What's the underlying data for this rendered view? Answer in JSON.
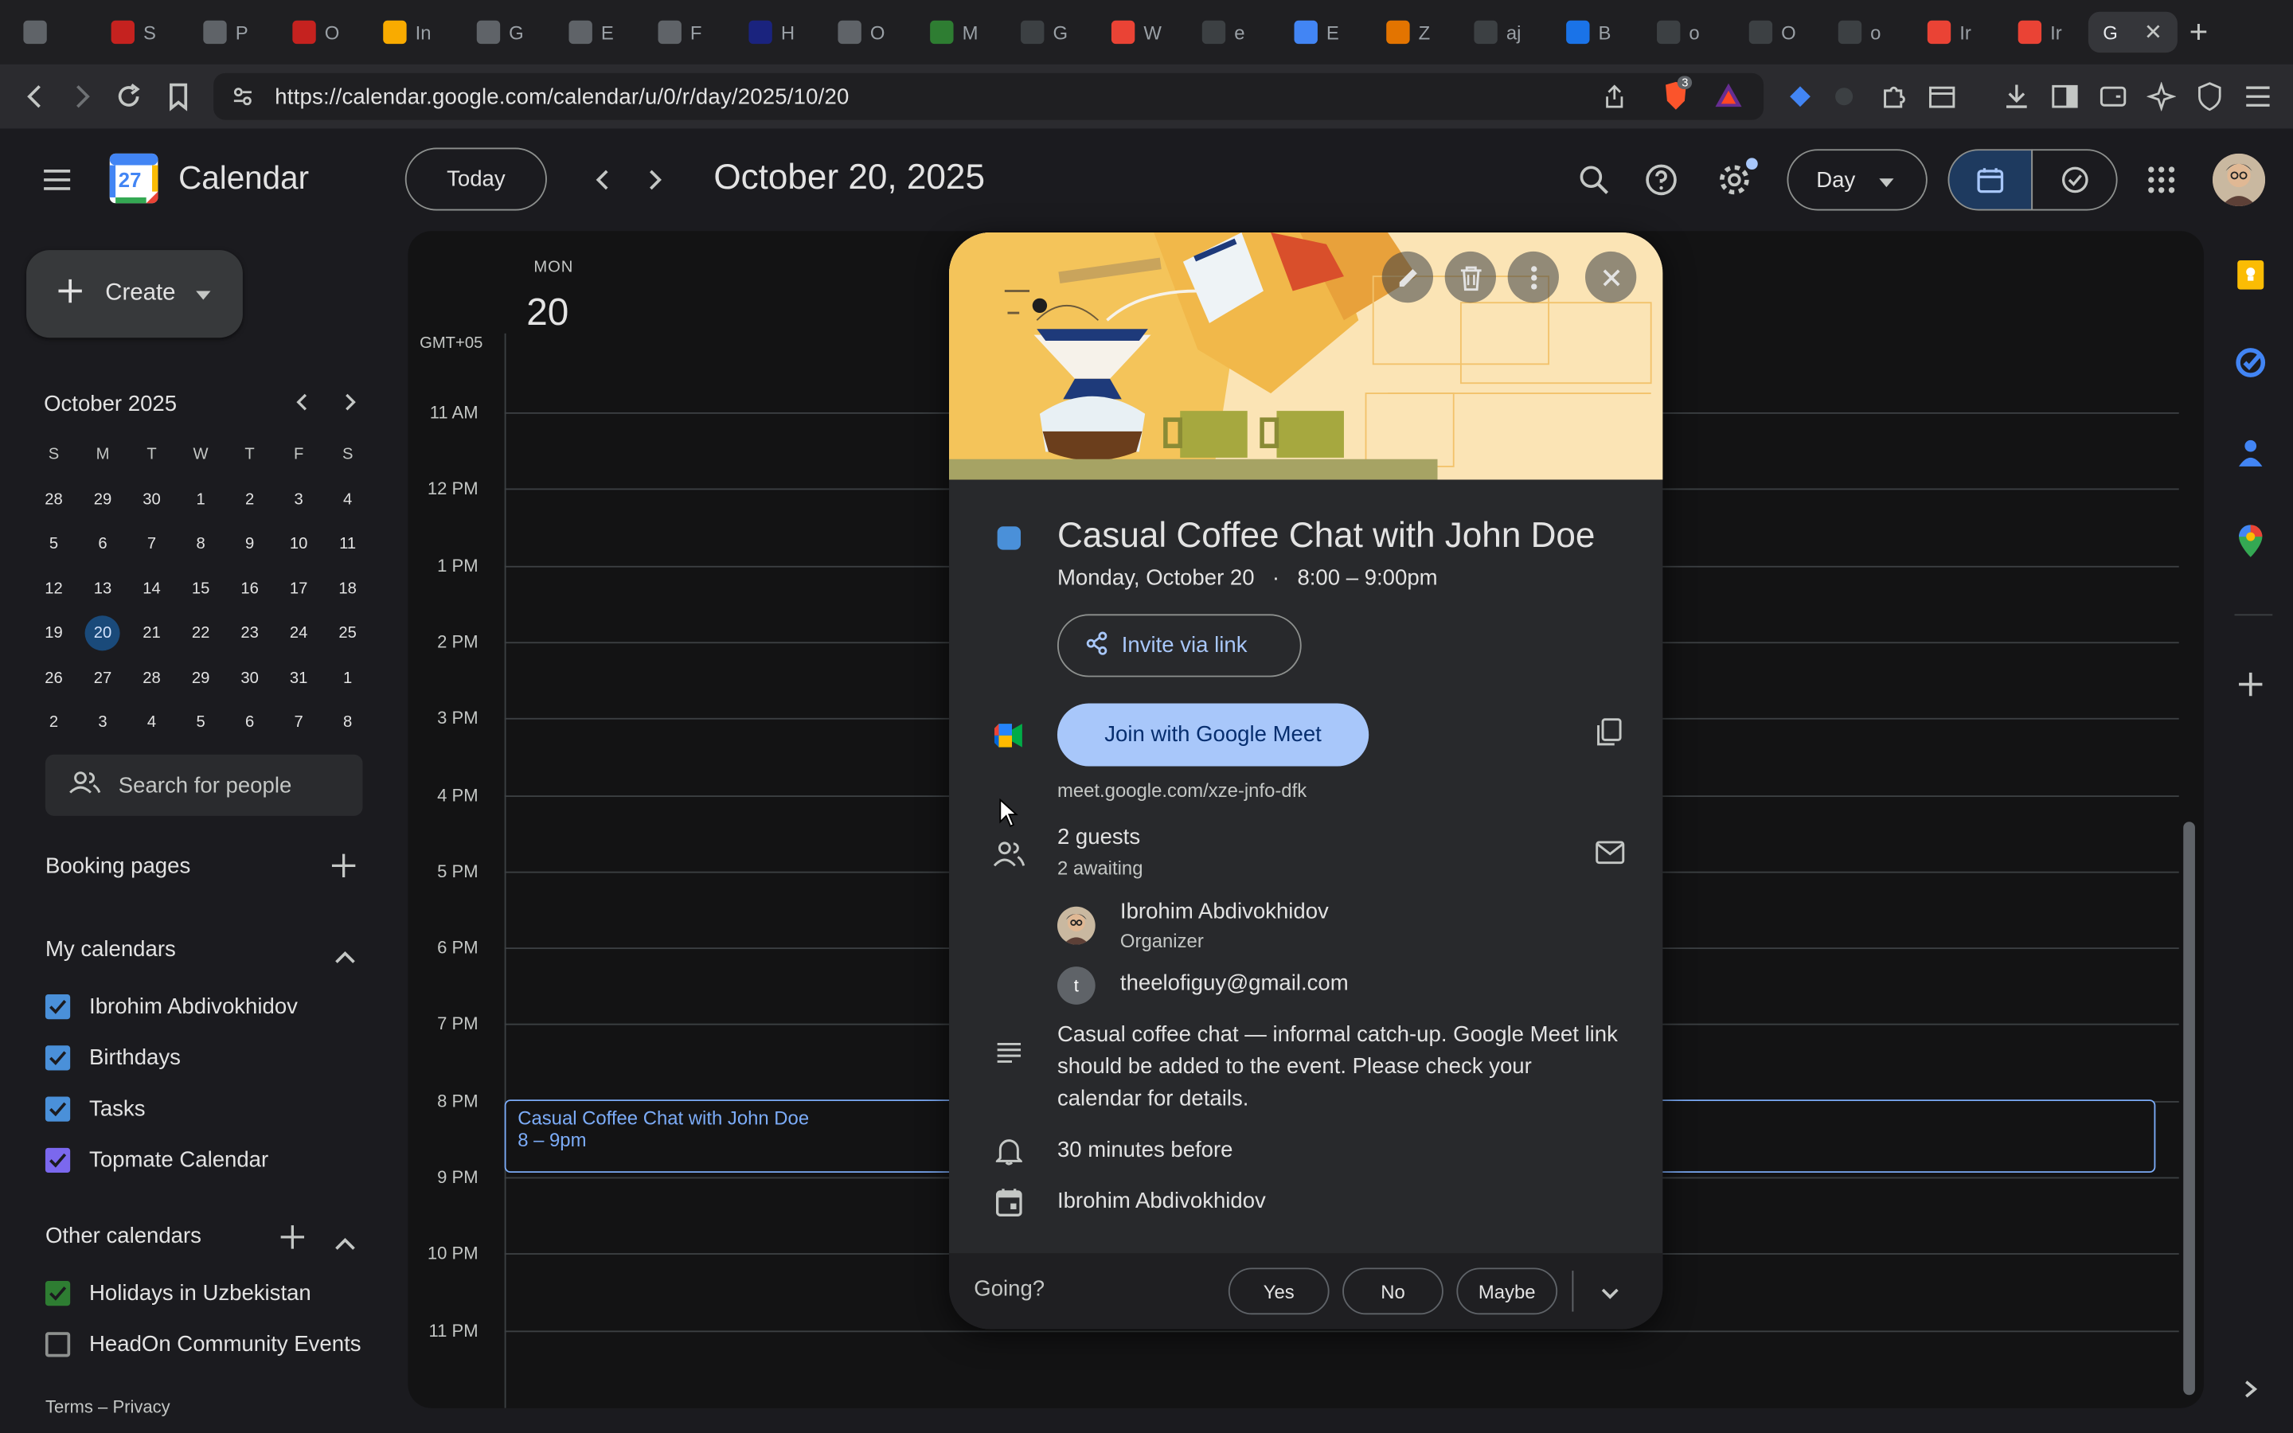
{
  "browser": {
    "tabs": [
      {
        "label": "S",
        "color": "#c5221f"
      },
      {
        "label": "P",
        "color": "#5f6368"
      },
      {
        "label": "O",
        "color": "#c5221f"
      },
      {
        "label": "In",
        "color": "#f9ab00"
      },
      {
        "label": "G",
        "color": "#5f6368"
      },
      {
        "label": "E",
        "color": "#5f6368"
      },
      {
        "label": "F",
        "color": "#5f6368"
      },
      {
        "label": "H",
        "color": "#1a237e"
      },
      {
        "label": "O",
        "color": "#5f6368"
      },
      {
        "label": "M",
        "color": "#2e7d32"
      },
      {
        "label": "G",
        "color": "#3c4043"
      },
      {
        "label": "W",
        "color": "#ea4335"
      },
      {
        "label": "e",
        "color": "#3c4043"
      },
      {
        "label": "E",
        "color": "#4285f4"
      },
      {
        "label": "Z",
        "color": "#e37400"
      },
      {
        "label": "aj",
        "color": "#3c4043"
      },
      {
        "label": "B",
        "color": "#1a73e8"
      },
      {
        "label": "o",
        "color": "#3c4043"
      },
      {
        "label": "O",
        "color": "#3c4043"
      },
      {
        "label": "o",
        "color": "#3c4043"
      },
      {
        "label": "Ir",
        "color": "#ea4335"
      },
      {
        "label": "Ir",
        "color": "#ea4335"
      }
    ],
    "active_tab": {
      "label": "G"
    },
    "url": "https://calendar.google.com/calendar/u/0/r/day/2025/10/20",
    "brave_badge": "3"
  },
  "header": {
    "app_name": "Calendar",
    "logo_day": "27",
    "today_label": "Today",
    "date_title": "October 20, 2025",
    "view_label": "Day"
  },
  "sidebar": {
    "create_label": "Create",
    "minical": {
      "title": "October 2025",
      "weekdays": [
        "S",
        "M",
        "T",
        "W",
        "T",
        "F",
        "S"
      ],
      "days": [
        "28",
        "29",
        "30",
        "1",
        "2",
        "3",
        "4",
        "5",
        "6",
        "7",
        "8",
        "9",
        "10",
        "11",
        "12",
        "13",
        "14",
        "15",
        "16",
        "17",
        "18",
        "19",
        "20",
        "21",
        "22",
        "23",
        "24",
        "25",
        "26",
        "27",
        "28",
        "29",
        "30",
        "31",
        "1",
        "2",
        "3",
        "4",
        "5",
        "6",
        "7",
        "8"
      ],
      "today": "20"
    },
    "search_people_placeholder": "Search for people",
    "booking_pages": "Booking pages",
    "my_calendars_title": "My calendars",
    "my_calendars": [
      {
        "name": "Ibrohim Abdivokhidov",
        "color": "#4a90d9",
        "checked": true
      },
      {
        "name": "Birthdays",
        "color": "#4a90d9",
        "checked": true
      },
      {
        "name": "Tasks",
        "color": "#4a90d9",
        "checked": true
      },
      {
        "name": "Topmate Calendar",
        "color": "#7b68ee",
        "checked": true
      }
    ],
    "other_calendars_title": "Other calendars",
    "other_calendars": [
      {
        "name": "Holidays in Uzbekistan",
        "color": "#2e7d32",
        "checked": true
      },
      {
        "name": "HeadOn Community Events",
        "color": "#5f6368",
        "checked": false
      }
    ],
    "footer": "Terms – Privacy"
  },
  "grid": {
    "dow": "MON",
    "day_number": "20",
    "timezone": "GMT+05",
    "hours": [
      "11 AM",
      "12 PM",
      "1 PM",
      "2 PM",
      "3 PM",
      "4 PM",
      "5 PM",
      "6 PM",
      "7 PM",
      "8 PM",
      "9 PM",
      "10 PM",
      "11 PM"
    ],
    "event_title": "Casual Coffee Chat with John Doe",
    "event_time": "8 – 9pm"
  },
  "popover": {
    "title": "Casual Coffee Chat with John Doe",
    "date": "Monday, October 20",
    "separator": "·",
    "time": "8:00 – 9:00pm",
    "invite_label": "Invite via link",
    "meet_label": "Join with Google Meet",
    "meet_url": "meet.google.com/xze-jnfo-dfk",
    "guests_count": "2 guests",
    "guests_status": "2 awaiting",
    "guests": [
      {
        "name": "Ibrohim Abdivokhidov",
        "role": "Organizer",
        "initial": ""
      },
      {
        "name": "theelofiguy@gmail.com",
        "role": "",
        "initial": "t"
      }
    ],
    "description": "Casual coffee chat — informal catch-up. Google Meet link should be added to the event. Please check your calendar for details.",
    "reminder": "30 minutes before",
    "calendar": "Ibrohim Abdivokhidov",
    "going_label": "Going?",
    "rsvp_yes": "Yes",
    "rsvp_no": "No",
    "rsvp_maybe": "Maybe"
  },
  "colors": {
    "accent": "#a8c7fa",
    "event": "#7cacf8",
    "today": "#1a4a7a"
  }
}
